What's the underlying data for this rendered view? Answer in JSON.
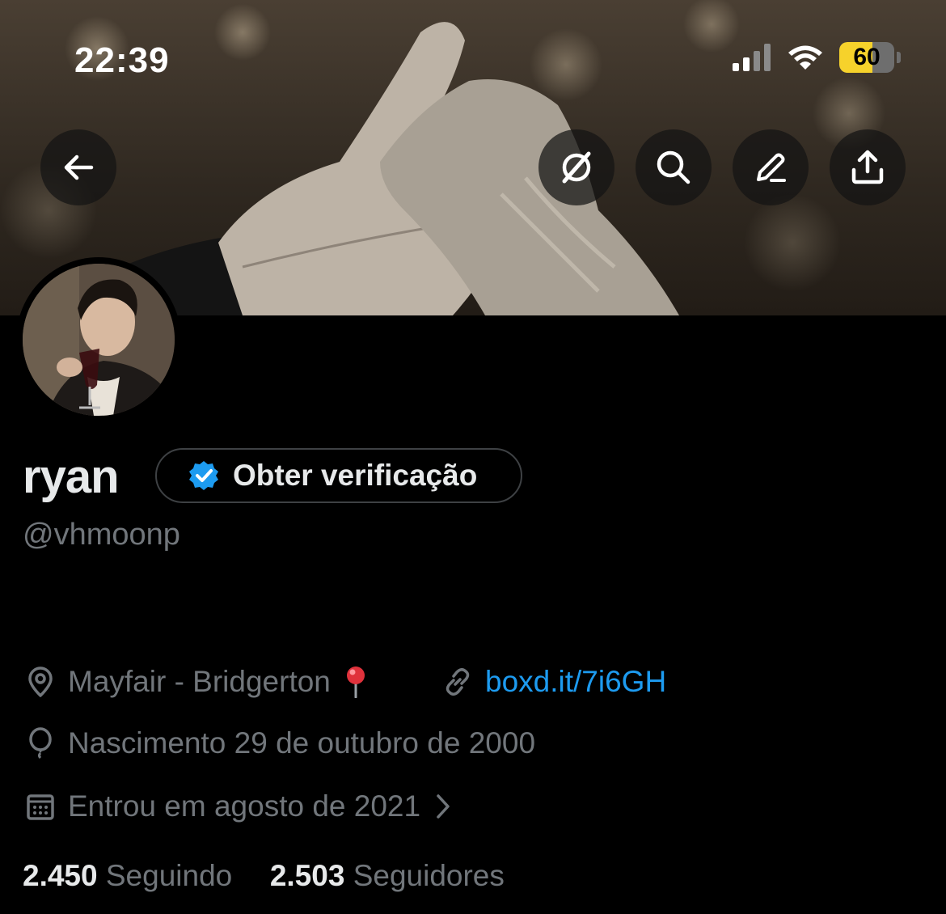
{
  "status_bar": {
    "time": "22:39",
    "battery_level": "60",
    "battery_fraction": 0.6
  },
  "header_actions": [
    "back",
    "grok",
    "search",
    "edit",
    "share"
  ],
  "profile": {
    "name": "ryan",
    "verify_button": "Obter verificação",
    "handle": "@vhmoonp",
    "location": "Mayfair - Bridgerton",
    "link": "boxd.it/7i6GH",
    "birthday": "Nascimento 29 de outubro de 2000",
    "joined": "Entrou em agosto de 2021",
    "following_count": "2.450",
    "following_label": "Seguindo",
    "followers_count": "2.503",
    "followers_label": "Seguidores"
  },
  "colors": {
    "background": "#000000",
    "link": "#1d9bf0",
    "muted": "#71767b",
    "text": "#e7e9ea",
    "battery": "#f6d22b"
  }
}
